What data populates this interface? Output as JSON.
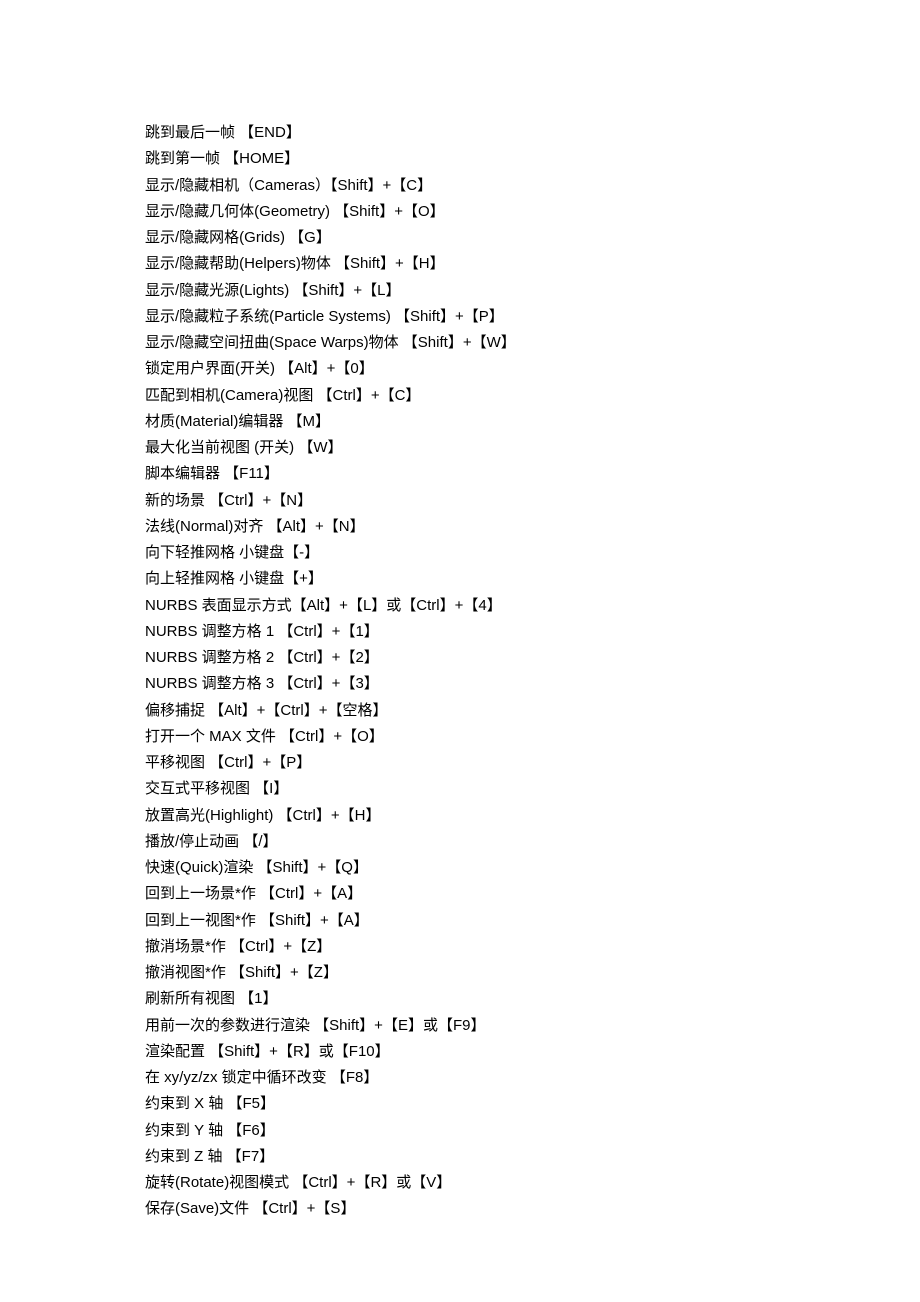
{
  "shortcuts": [
    "跳到最后一帧 【END】",
    "跳到第一帧 【HOME】",
    "显示/隐藏相机（Cameras）【Shift】+【C】",
    "显示/隐藏几何体(Geometry) 【Shift】+【O】",
    "显示/隐藏网格(Grids) 【G】",
    "显示/隐藏帮助(Helpers)物体 【Shift】+【H】",
    "显示/隐藏光源(Lights) 【Shift】+【L】",
    "显示/隐藏粒子系统(Particle Systems) 【Shift】+【P】",
    "显示/隐藏空间扭曲(Space Warps)物体 【Shift】+【W】",
    "锁定用户界面(开关) 【Alt】+【0】",
    "匹配到相机(Camera)视图 【Ctrl】+【C】",
    "材质(Material)编辑器 【M】",
    "最大化当前视图 (开关) 【W】",
    "脚本编辑器 【F11】",
    "新的场景 【Ctrl】+【N】",
    "法线(Normal)对齐 【Alt】+【N】",
    "向下轻推网格 小键盘【-】",
    "向上轻推网格 小键盘【+】",
    "NURBS 表面显示方式【Alt】+【L】或【Ctrl】+【4】",
    "NURBS 调整方格 1 【Ctrl】+【1】",
    "NURBS 调整方格 2 【Ctrl】+【2】",
    "NURBS 调整方格 3 【Ctrl】+【3】",
    "偏移捕捉 【Alt】+【Ctrl】+【空格】",
    "打开一个 MAX 文件 【Ctrl】+【O】",
    "平移视图 【Ctrl】+【P】",
    "交互式平移视图 【I】",
    "放置高光(Highlight) 【Ctrl】+【H】",
    "播放/停止动画 【/】",
    "快速(Quick)渲染 【Shift】+【Q】",
    "回到上一场景*作 【Ctrl】+【A】",
    "回到上一视图*作 【Shift】+【A】",
    "撤消场景*作 【Ctrl】+【Z】",
    "撤消视图*作 【Shift】+【Z】",
    "刷新所有视图 【1】",
    "用前一次的参数进行渲染 【Shift】+【E】或【F9】",
    "渲染配置 【Shift】+【R】或【F10】",
    "在 xy/yz/zx 锁定中循环改变 【F8】",
    "约束到 X 轴 【F5】",
    "约束到 Y 轴 【F6】",
    "约束到 Z 轴 【F7】",
    "旋转(Rotate)视图模式 【Ctrl】+【R】或【V】",
    "保存(Save)文件 【Ctrl】+【S】"
  ]
}
